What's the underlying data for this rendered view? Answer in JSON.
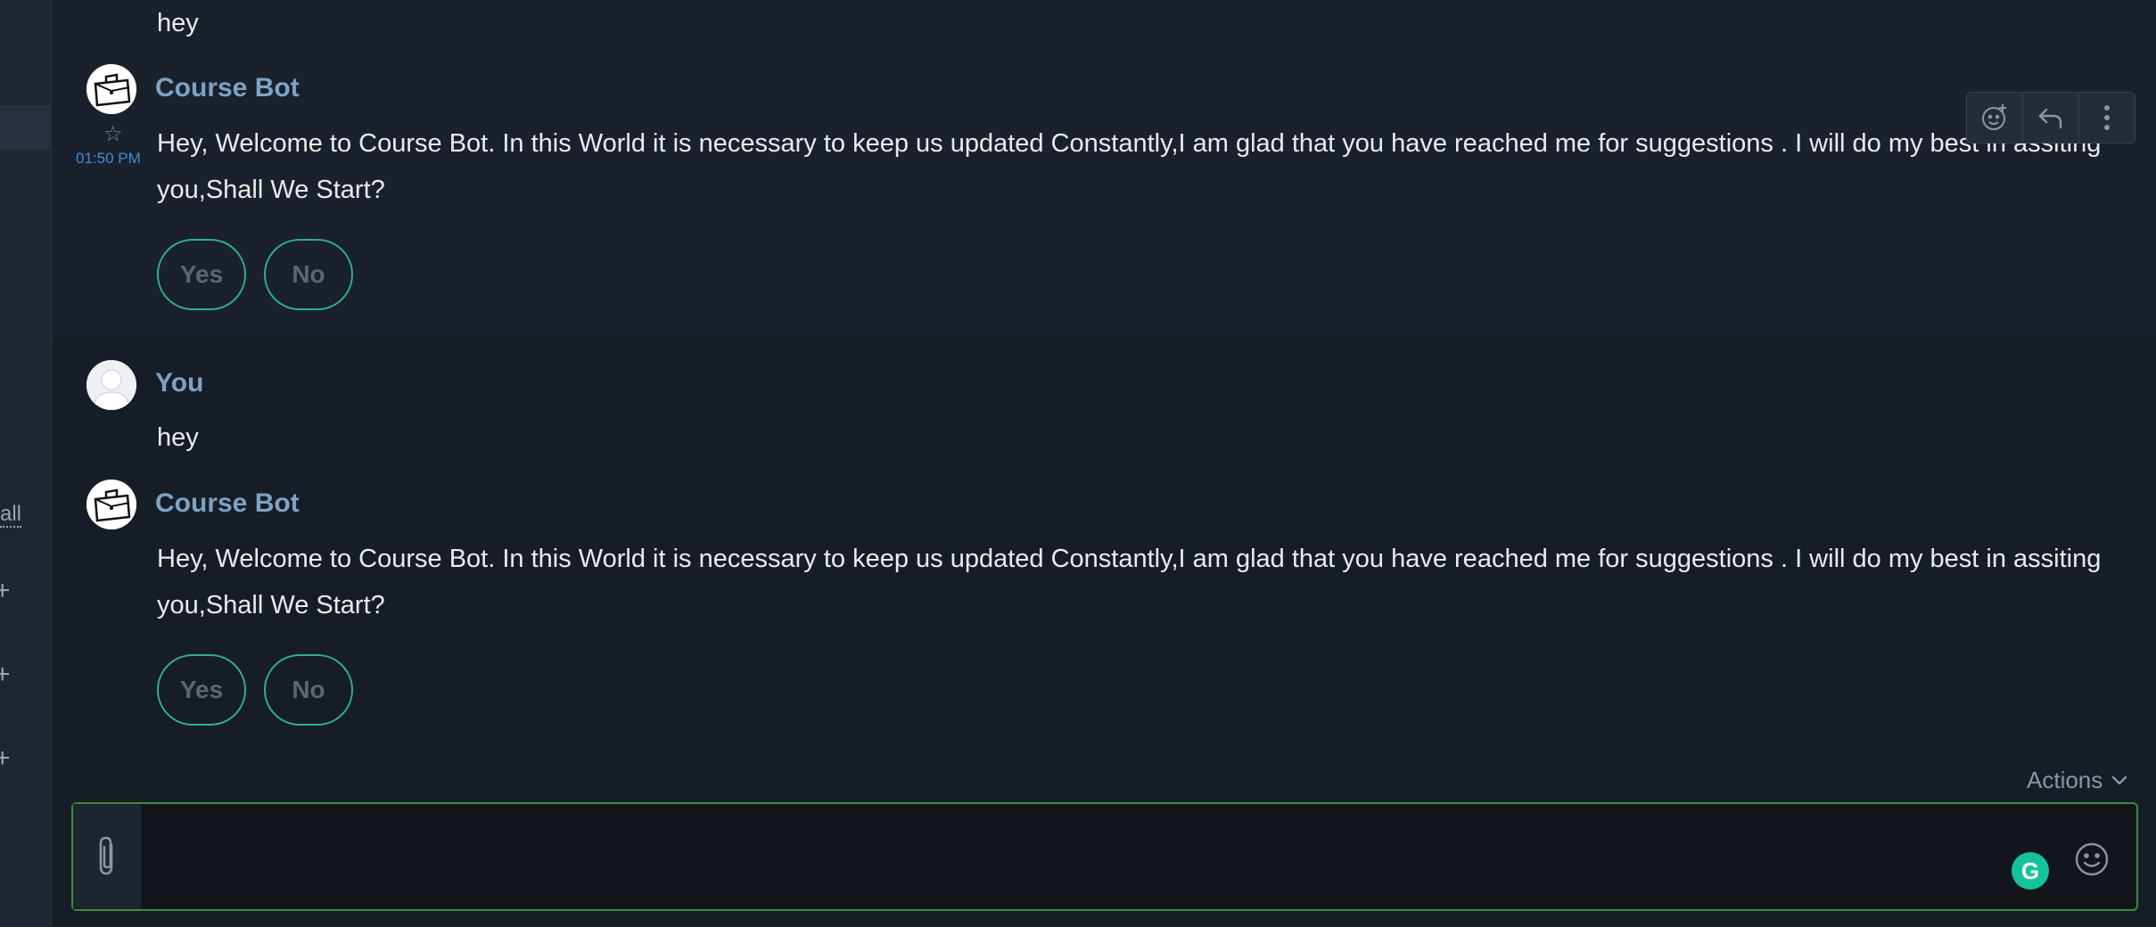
{
  "sidebar": {
    "all_link": "all",
    "plus_glyph": "+"
  },
  "messages": [
    {
      "text": "hey"
    },
    {
      "author": "Course Bot",
      "avatar_icon": "briefcase-avatar-icon",
      "time": "01:50 PM",
      "text_line1": "Hey, Welcome to Course Bot. In this World it is necessary to keep us updated Constantly,I am glad that you have reached me for suggestions . I will do my best in assiting",
      "text_line2": "you,Shall We Start?",
      "quick_replies": [
        "Yes",
        "No"
      ]
    },
    {
      "author": "You",
      "avatar_icon": "user-avatar-icon",
      "text": "hey"
    },
    {
      "author": "Course Bot",
      "avatar_icon": "briefcase-avatar-icon",
      "text_line1": "Hey, Welcome to Course Bot. In this World it is necessary to keep us updated Constantly,I am glad that you have reached me for suggestions . I will do my best in assiting",
      "text_line2": "you,Shall We Start?",
      "quick_replies": [
        "Yes",
        "No"
      ]
    }
  ],
  "message_toolbar": {
    "icons": [
      "add-reaction-icon",
      "reply-icon",
      "more-options-icon"
    ]
  },
  "composer": {
    "actions_label": "Actions",
    "placeholder": "",
    "grammarly_letter": "G",
    "attach_icon": "paperclip-icon",
    "emoji_icon": "emoji-icon"
  },
  "colors": {
    "background": "#171d26",
    "author_name": "#7ea2c4",
    "timestamp": "#3f8dd8",
    "quick_reply_border": "#2fb08a",
    "composer_border": "#3f8a3e",
    "grammarly": "#15c39a"
  }
}
